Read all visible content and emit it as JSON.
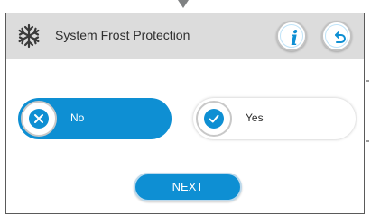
{
  "header": {
    "title": "System Frost Protection",
    "icon": "snowflake-icon",
    "buttons": [
      {
        "name": "info-button",
        "icon": "info-icon",
        "glyph": "i"
      },
      {
        "name": "back-button",
        "icon": "back-arrow-icon"
      }
    ]
  },
  "options": [
    {
      "label": "No",
      "icon": "close-icon",
      "selected": true
    },
    {
      "label": "Yes",
      "icon": "check-icon",
      "selected": false
    }
  ],
  "footer": {
    "next_label": "NEXT"
  },
  "colors": {
    "accent": "#0e8fd3",
    "header_bg": "#dcdcdc",
    "text": "#2f2f2f"
  }
}
